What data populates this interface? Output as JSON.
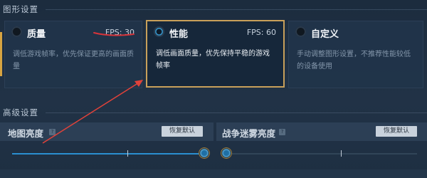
{
  "graphics_section": {
    "title": "图形设置",
    "cards": [
      {
        "title": "质量",
        "fps": "FPS: 30",
        "description": "调低游戏帧率，优先保证更高的画面质量",
        "selected": false
      },
      {
        "title": "性能",
        "fps": "FPS: 60",
        "description": "调低画面质量，优先保持平稳的游戏帧率",
        "selected": true
      },
      {
        "title": "自定义",
        "fps": "",
        "description": "手动调整图形设置，不推荐性能较低的设备使用",
        "selected": false
      }
    ]
  },
  "advanced_section": {
    "title": "高级设置",
    "settings": [
      {
        "label": "地图亮度",
        "reset_label": "恢复默认",
        "value_percent": 100
      },
      {
        "label": "战争迷雾亮度",
        "reset_label": "恢复默认",
        "value_percent": 0
      }
    ]
  },
  "colors": {
    "accent_gold": "#c8a05a",
    "slider_blue": "#2a8fd0",
    "annotation_red": "#e0423a"
  }
}
